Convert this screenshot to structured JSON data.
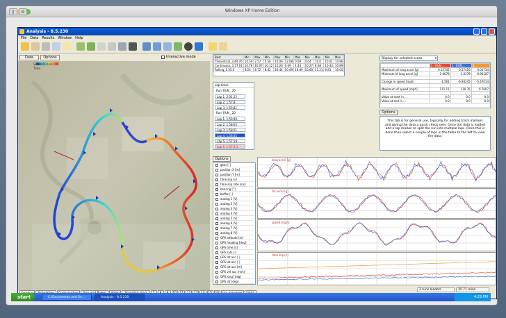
{
  "vm": {
    "title": "Windows XP Home Edition"
  },
  "app": {
    "title": "Analysis - 8.5.230",
    "menu": [
      "File",
      "Data",
      "Results",
      "Window",
      "Help"
    ]
  },
  "map_pane": {
    "tabs": [
      "Data",
      "Options"
    ],
    "interactive_label": "Interactive mode",
    "legend_label": "Scale (100m)",
    "legend_sub": "Time"
  },
  "stats_table": {
    "headers": [
      "Best",
      "Min",
      "Max",
      "Min",
      "Max",
      "Min",
      "Max",
      "Min",
      "Max",
      "Min",
      "Max"
    ],
    "rows": [
      [
        "Theoretical_3.40.76",
        "14.59",
        "2.57",
        "0.56",
        "10.06",
        "12.08",
        "0.69",
        "4.04",
        "10.0",
        "10.01",
        "14.96"
      ],
      [
        "Continuous_3.57.01",
        "14.76",
        "10.07",
        "10.12",
        "12.26",
        "0.69",
        "4.44",
        "10.27",
        "8.68",
        "10.44",
        "10.89"
      ],
      [
        "Rolling_1.35.0",
        "8.24",
        "8.72",
        "8.62",
        "16.44",
        "10.49",
        "10.49",
        "10.60",
        "13.21",
        "9.81",
        "10.05"
      ]
    ]
  },
  "lap_list": {
    "header": "Lap times",
    "items": [
      "Run 'RUN__20'",
      "Lap 1: 2:01.22",
      "Lap 2: 1:57.8",
      "Lap 3: 1:59.81",
      "Run 'RUN__20'",
      "Lap 1: 1:59.80",
      "Lap 2: 1:58.65",
      "Lap 3: 1:58.01",
      "Lap 4: 1:58.45",
      "Lap 5: 1:57.59",
      "Lap 6: 1:57.8.1"
    ]
  },
  "selected_areas": {
    "dropdown": "Display for selected areas",
    "col_headers": [
      "",
      "1 : RUN_...",
      "2 : RUN_...",
      "Δ"
    ],
    "rows": [
      [
        "Maximum of long accel [g]",
        "0.55742",
        "0.57456",
        "0.01714"
      ],
      [
        "Minimum of long accel [g]",
        "-1.0678",
        "-1.0378",
        "-0.96187"
      ],
      [
        "",
        "",
        "",
        ""
      ],
      [
        "Change in speed [mph]",
        "-1.561",
        "-6.94345",
        "-5.47014"
      ],
      [
        "",
        "",
        "",
        ""
      ],
      [
        "Maximum of speed [mph]",
        "111.11",
        "110.35",
        "0.7607"
      ],
      [
        "",
        "",
        "",
        ""
      ],
      [
        "Value at start in ...",
        "0.0",
        "0.0",
        "0.0"
      ],
      [
        "Value at end in ...",
        "0.0",
        "0.0",
        "0.0"
      ]
    ]
  },
  "options_panel": {
    "tab": "Options",
    "text": "This tab is for general use, typically for adding track markers and giving the data a quick check over. Once the data is loaded add a lap marker to split the run into multiple laps. Once this is done then select a couple of laps in the table to the left to view the data."
  },
  "channels": {
    "tab": "Options",
    "items": [
      "gear [-]",
      "position X [m]",
      "position Y [m]",
      "time slip [s]",
      "time slip rate [s/s]",
      "bearing [°]",
      "buffer [-]",
      "analog 1 [V]",
      "analog 2 [V]",
      "analog 3 [V]",
      "analog 4 [V]",
      "analog 5 [V]",
      "analog 6 [V]",
      "analog 7 [V]",
      "analog 8 [V]",
      "GPS altitude [m]",
      "GPS heading [deg]",
      "GPS time [s]",
      "GPS sats [-]",
      "GPS lat acc [-]",
      "GPS lat acc [-]",
      "GPS alt acc [m]",
      "GPS vel acc [m/s]",
      "GPS long [deg]",
      "GPS lat [deg]"
    ]
  },
  "plots": [
    {
      "label": "long accel [g]"
    },
    {
      "label": "lat accel [g]"
    },
    {
      "label": "speed [mph]"
    },
    {
      "label": "time slip [s]"
    }
  ],
  "status": {
    "runs_loaded": "2 runs loaded",
    "time": "35.71 mins"
  },
  "bottom_tabs": [
    "General",
    "Simulation",
    "Comparative",
    "Grip and Power",
    "Video",
    "Standing start",
    "7",
    "8",
    "9",
    "10",
    "11",
    "12",
    "13",
    "14",
    "15",
    "16",
    "run manager",
    "Units"
  ],
  "taskbar": {
    "start": "start",
    "tasks": [
      "C:\\Documents and Se...",
      "Analysis - 8.5.230"
    ],
    "clock": "4:23 PM"
  },
  "colors": {
    "accent": "#0a5fd8",
    "run1": "#e64a2e",
    "run2": "#3f6fd8",
    "run3": "#f39a32"
  }
}
